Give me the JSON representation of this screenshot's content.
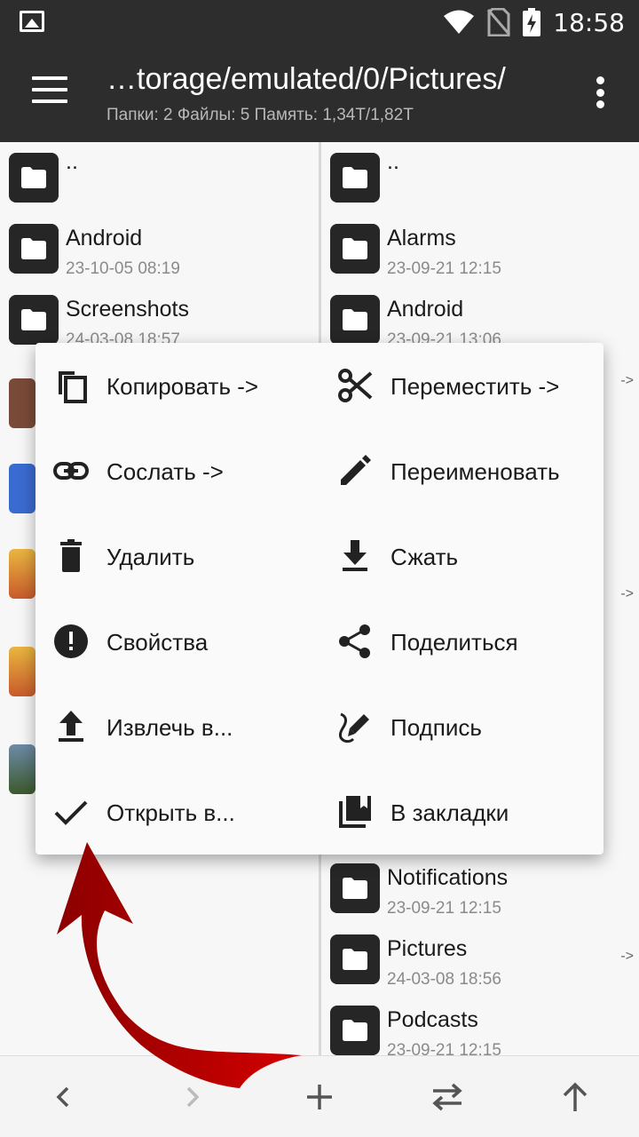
{
  "statusbar": {
    "time": "18:58"
  },
  "toolbar": {
    "title": "…torage/emulated/0/Pictures/",
    "subtitle": "Папки: 2  Файлы: 5  Память: 1,34T/1,82T"
  },
  "left_pane": {
    "items": [
      {
        "name": "..",
        "date": ""
      },
      {
        "name": "Android",
        "date": "23-10-05 08:19"
      },
      {
        "name": "Screenshots",
        "date": "24-03-08 18:57"
      }
    ]
  },
  "right_pane": {
    "items_top": [
      {
        "name": "..",
        "date": ""
      },
      {
        "name": "Alarms",
        "date": "23-09-21 12:15"
      },
      {
        "name": "Android",
        "date": "23-09-21 13:06"
      }
    ],
    "items_bottom": [
      {
        "name": "Notifications",
        "date": "23-09-21 12:15"
      },
      {
        "name": "Pictures",
        "date": "24-03-08 18:56"
      },
      {
        "name": "Podcasts",
        "date": "23-09-21 12:15"
      }
    ],
    "arrow": "->"
  },
  "context_menu": {
    "copy": "Копировать ->",
    "move": "Переместить ->",
    "link": "Сослать ->",
    "rename": "Переименовать",
    "delete": "Удалить",
    "compress": "Сжать",
    "properties": "Свойства",
    "share": "Поделиться",
    "extract": "Извлечь в...",
    "sign": "Подпись",
    "open_in": "Открыть в...",
    "bookmark": "В закладки"
  },
  "colors": {
    "toolbar": "#2d2d2d",
    "accent_arrow": "#cc0000",
    "folder_icon": "#262626"
  }
}
